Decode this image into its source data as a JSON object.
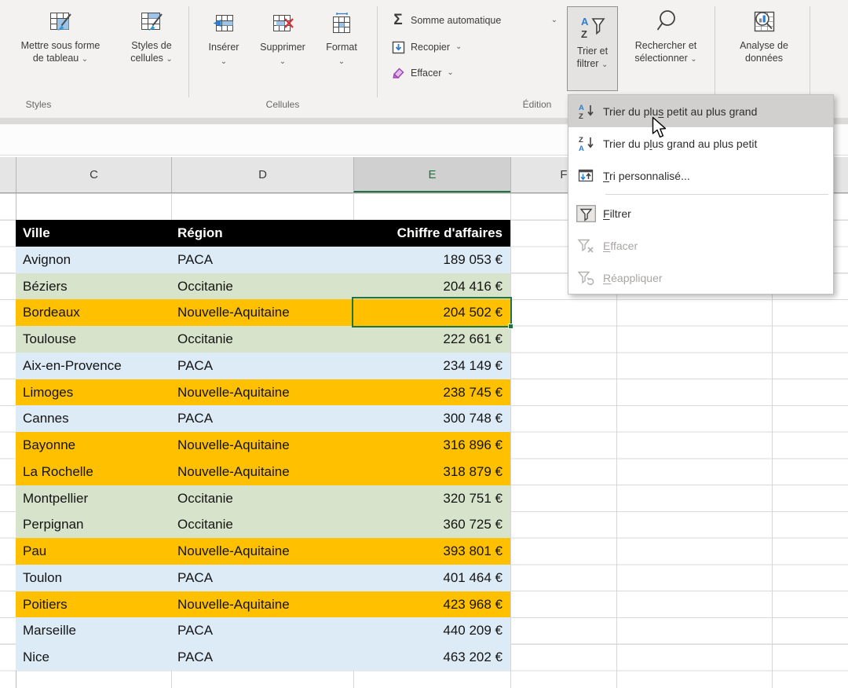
{
  "ribbon": {
    "sigma": "Σ",
    "styles_group": {
      "label": "Styles",
      "format_table_l1": "Mettre sous forme",
      "format_table_l2": "de tableau",
      "cell_styles_l1": "Styles de",
      "cell_styles_l2": "cellules"
    },
    "cells_group": {
      "label": "Cellules",
      "insert": "Insérer",
      "delete": "Supprimer",
      "format": "Format"
    },
    "editing_group": {
      "label": "Édition",
      "autosum": "Somme automatique",
      "fill": "Recopier",
      "clear": "Effacer",
      "sort_filter_l1": "Trier et",
      "sort_filter_l2": "filtrer",
      "find_select_l1": "Rechercher et",
      "find_select_l2": "sélectionner",
      "analyze_l1": "Analyse de",
      "analyze_l2": "données"
    }
  },
  "sort_menu": {
    "items": [
      {
        "pre": "Trier du plu",
        "key": "s",
        "post": " petit au plus grand"
      },
      {
        "pre": "Trier du p",
        "key": "l",
        "post": "us grand au plus petit"
      },
      {
        "pre": "",
        "key": "T",
        "post": "ri personnalisé..."
      },
      {
        "pre": "",
        "key": "F",
        "post": "iltrer"
      },
      {
        "pre": "",
        "key": "E",
        "post": "ffacer"
      },
      {
        "pre": "",
        "key": "R",
        "post": "éappliquer"
      }
    ]
  },
  "sheet": {
    "column_headers": {
      "c": "C",
      "d": "D",
      "e": "E",
      "f": "F"
    },
    "selected_column": "E",
    "selection_color": "#217346",
    "region_colors": {
      "PACA": "#DDEBF7",
      "Occitanie": "#D7E4CB",
      "Nouvelle-Aquitaine": "#FFC000"
    },
    "table": {
      "headers": [
        "Ville",
        "Région",
        "Chiffre d'affaires"
      ],
      "rows": [
        {
          "ville": "Avignon",
          "region": "PACA",
          "ca": "189 053 €"
        },
        {
          "ville": "Béziers",
          "region": "Occitanie",
          "ca": "204 416 €"
        },
        {
          "ville": "Bordeaux",
          "region": "Nouvelle-Aquitaine",
          "ca": "204 502 €"
        },
        {
          "ville": "Toulouse",
          "region": "Occitanie",
          "ca": "222 661 €"
        },
        {
          "ville": "Aix-en-Provence",
          "region": "PACA",
          "ca": "234 149 €"
        },
        {
          "ville": "Limoges",
          "region": "Nouvelle-Aquitaine",
          "ca": "238 745 €"
        },
        {
          "ville": "Cannes",
          "region": "PACA",
          "ca": "300 748 €"
        },
        {
          "ville": "Bayonne",
          "region": "Nouvelle-Aquitaine",
          "ca": "316 896 €"
        },
        {
          "ville": "La Rochelle",
          "region": "Nouvelle-Aquitaine",
          "ca": "318 879 €"
        },
        {
          "ville": "Montpellier",
          "region": "Occitanie",
          "ca": "320 751 €"
        },
        {
          "ville": "Perpignan",
          "region": "Occitanie",
          "ca": "360 725 €"
        },
        {
          "ville": "Pau",
          "region": "Nouvelle-Aquitaine",
          "ca": "393 801 €"
        },
        {
          "ville": "Toulon",
          "region": "PACA",
          "ca": "401 464 €"
        },
        {
          "ville": "Poitiers",
          "region": "Nouvelle-Aquitaine",
          "ca": "423 968 €"
        },
        {
          "ville": "Marseille",
          "region": "PACA",
          "ca": "440 209 €"
        },
        {
          "ville": "Nice",
          "region": "PACA",
          "ca": "463 202 €"
        }
      ]
    }
  }
}
